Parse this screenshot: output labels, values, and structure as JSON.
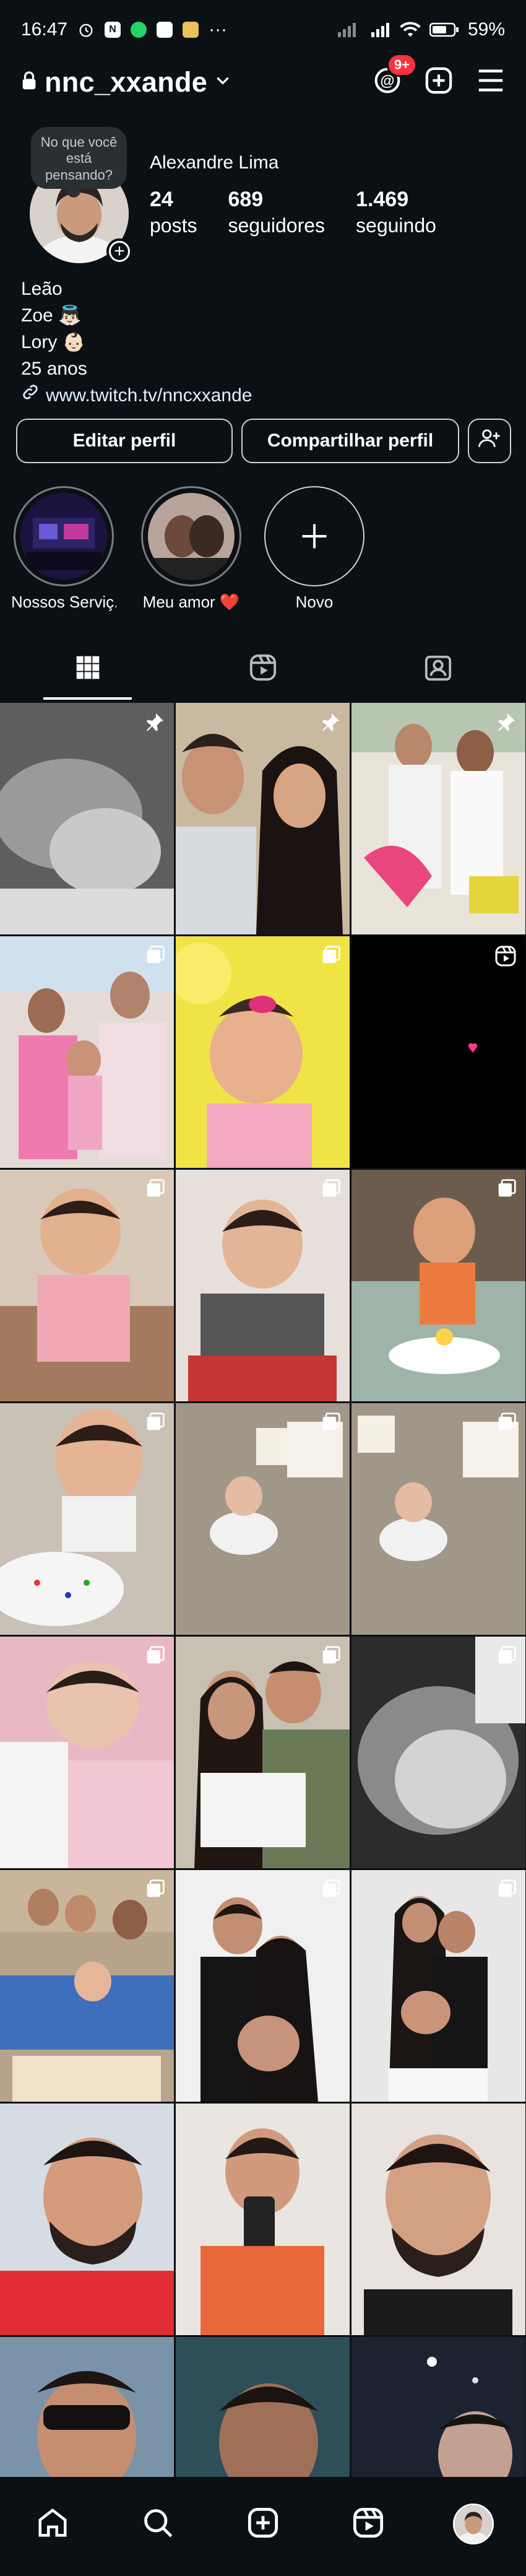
{
  "status_bar": {
    "time": "16:47",
    "battery": "59%"
  },
  "header": {
    "username": "nnc_xxande",
    "threads_badge": "9+"
  },
  "profile": {
    "note": "No que você está pensando?",
    "full_name": "Alexandre Lima",
    "stats": [
      {
        "value": "24",
        "label": "posts"
      },
      {
        "value": "689",
        "label": "seguidores"
      },
      {
        "value": "1.469",
        "label": "seguindo"
      }
    ],
    "bio_lines": [
      "Leão",
      "Zoe 👼🏻",
      "Lory 👶🏻",
      "25 anos"
    ],
    "link": "www.twitch.tv/nncxxande"
  },
  "buttons": {
    "edit": "Editar perfil",
    "share": "Compartilhar perfil"
  },
  "highlights": [
    {
      "label": "Nossos Serviç..."
    },
    {
      "label": "Meu amor ❤️"
    },
    {
      "label": "Novo"
    }
  ],
  "colors": {
    "background": "#0b1014",
    "badge": "#ff3040",
    "text": "#ffffff"
  }
}
